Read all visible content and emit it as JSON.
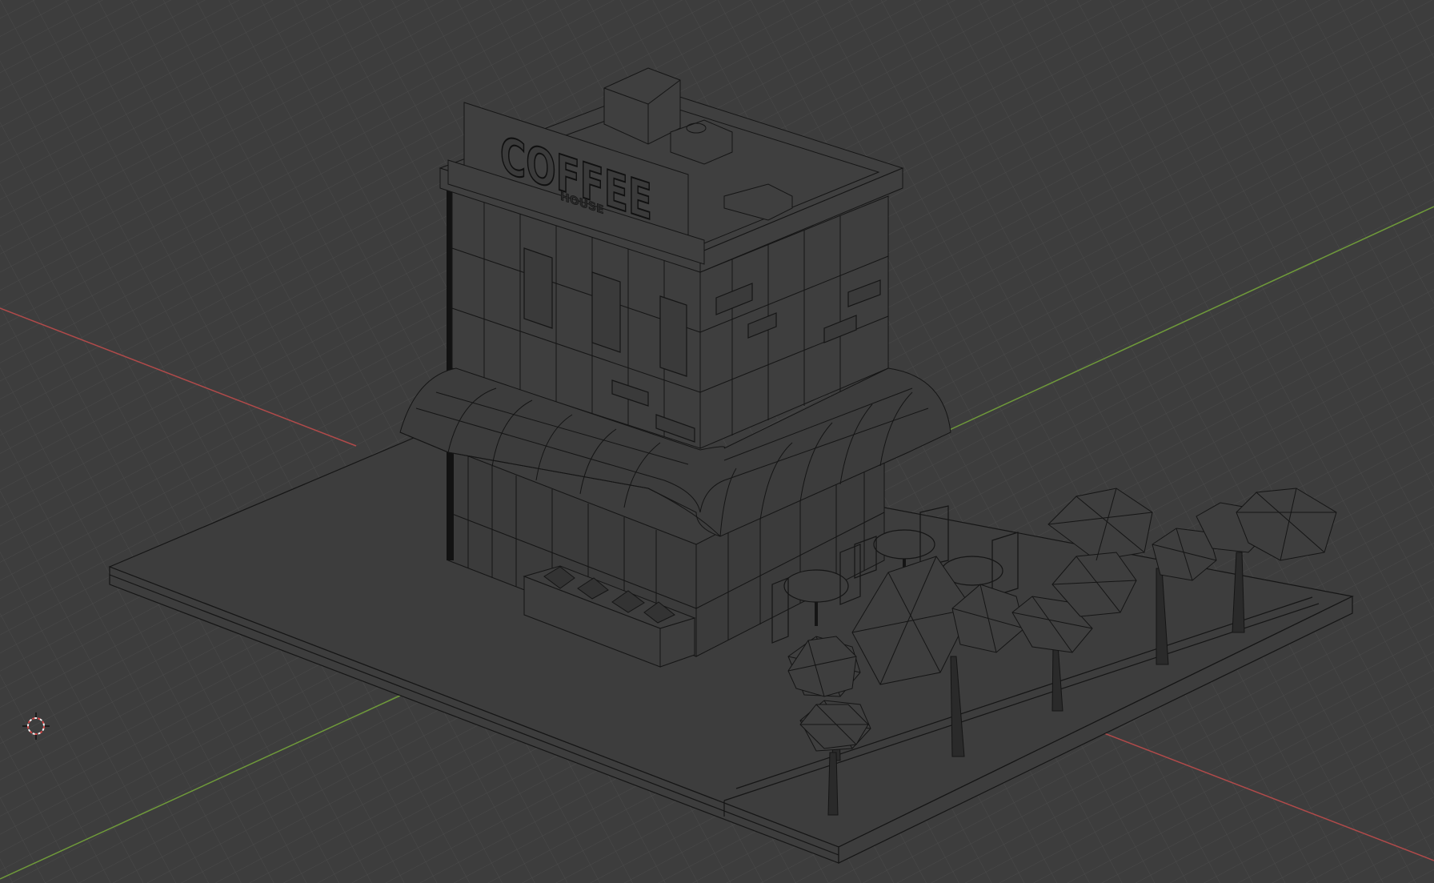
{
  "viewport": {
    "background": "#3d3d3d",
    "grid_color": "#4a4a4a",
    "x_axis_color": "#b04a4a",
    "y_axis_color": "#6f9a3a",
    "wire_color": "#151515"
  },
  "scene": {
    "sign_main": "COFFEE",
    "sign_sub": "HOUSE"
  },
  "cursor_icon": "3d-cursor-icon"
}
